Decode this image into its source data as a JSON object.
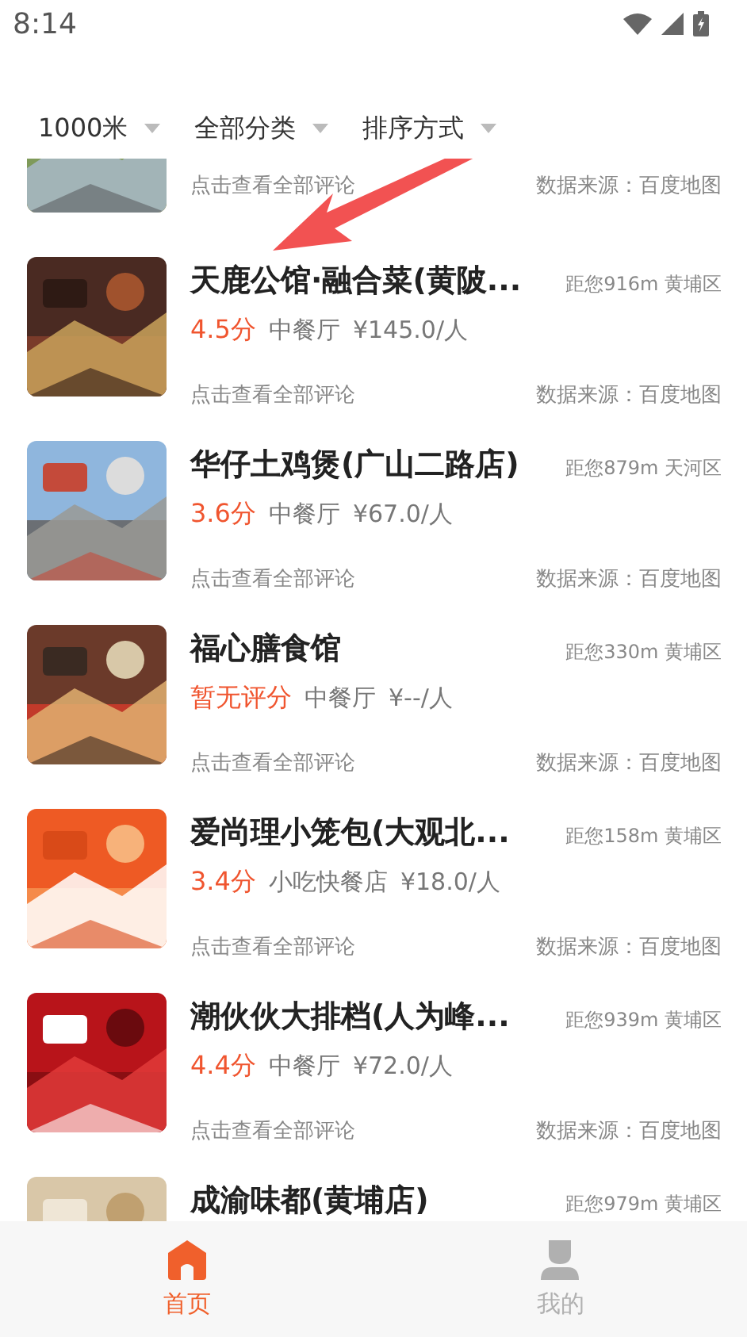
{
  "status_bar": {
    "time": "8:14"
  },
  "filters": [
    {
      "label": "1000米"
    },
    {
      "label": "全部分类"
    },
    {
      "label": "排序方式"
    }
  ],
  "restaurants": [
    {
      "kind": "partial",
      "reviews_link": "点击查看全部评论",
      "source": "数据来源：百度地图"
    },
    {
      "kind": "full",
      "name": "天鹿公馆·融合菜(黄陂...",
      "distance": "距您916m 黄埔区",
      "rating": "4.5分",
      "category": "中餐厅",
      "price": "¥145.0/人",
      "reviews_link": "点击查看全部评论",
      "source": "数据来源：百度地图"
    },
    {
      "kind": "full",
      "name": "华仔土鸡煲(广山二路店)",
      "distance": "距您879m 天河区",
      "rating": "3.6分",
      "category": "中餐厅",
      "price": "¥67.0/人",
      "reviews_link": "点击查看全部评论",
      "source": "数据来源：百度地图"
    },
    {
      "kind": "full",
      "name": "福心膳食馆",
      "distance": "距您330m 黄埔区",
      "rating": "暂无评分",
      "category": "中餐厅",
      "price": "¥--/人",
      "reviews_link": "点击查看全部评论",
      "source": "数据来源：百度地图"
    },
    {
      "kind": "full",
      "name": "爱尚理小笼包(大观北...",
      "distance": "距您158m 黄埔区",
      "rating": "3.4分",
      "category": "小吃快餐店",
      "price": "¥18.0/人",
      "reviews_link": "点击查看全部评论",
      "source": "数据来源：百度地图"
    },
    {
      "kind": "full",
      "name": "潮伙伙大排档(人为峰...",
      "distance": "距您939m 黄埔区",
      "rating": "4.4分",
      "category": "中餐厅",
      "price": "¥72.0/人",
      "reviews_link": "点击查看全部评论",
      "source": "数据来源：百度地图"
    },
    {
      "kind": "top",
      "name": "成渝味都(黄埔店)",
      "distance": "距您979m 黄埔区"
    }
  ],
  "tab_bar": [
    {
      "label": "首页",
      "kind": "home",
      "selected": true
    },
    {
      "label": "我的",
      "kind": "person",
      "selected": false
    }
  ]
}
